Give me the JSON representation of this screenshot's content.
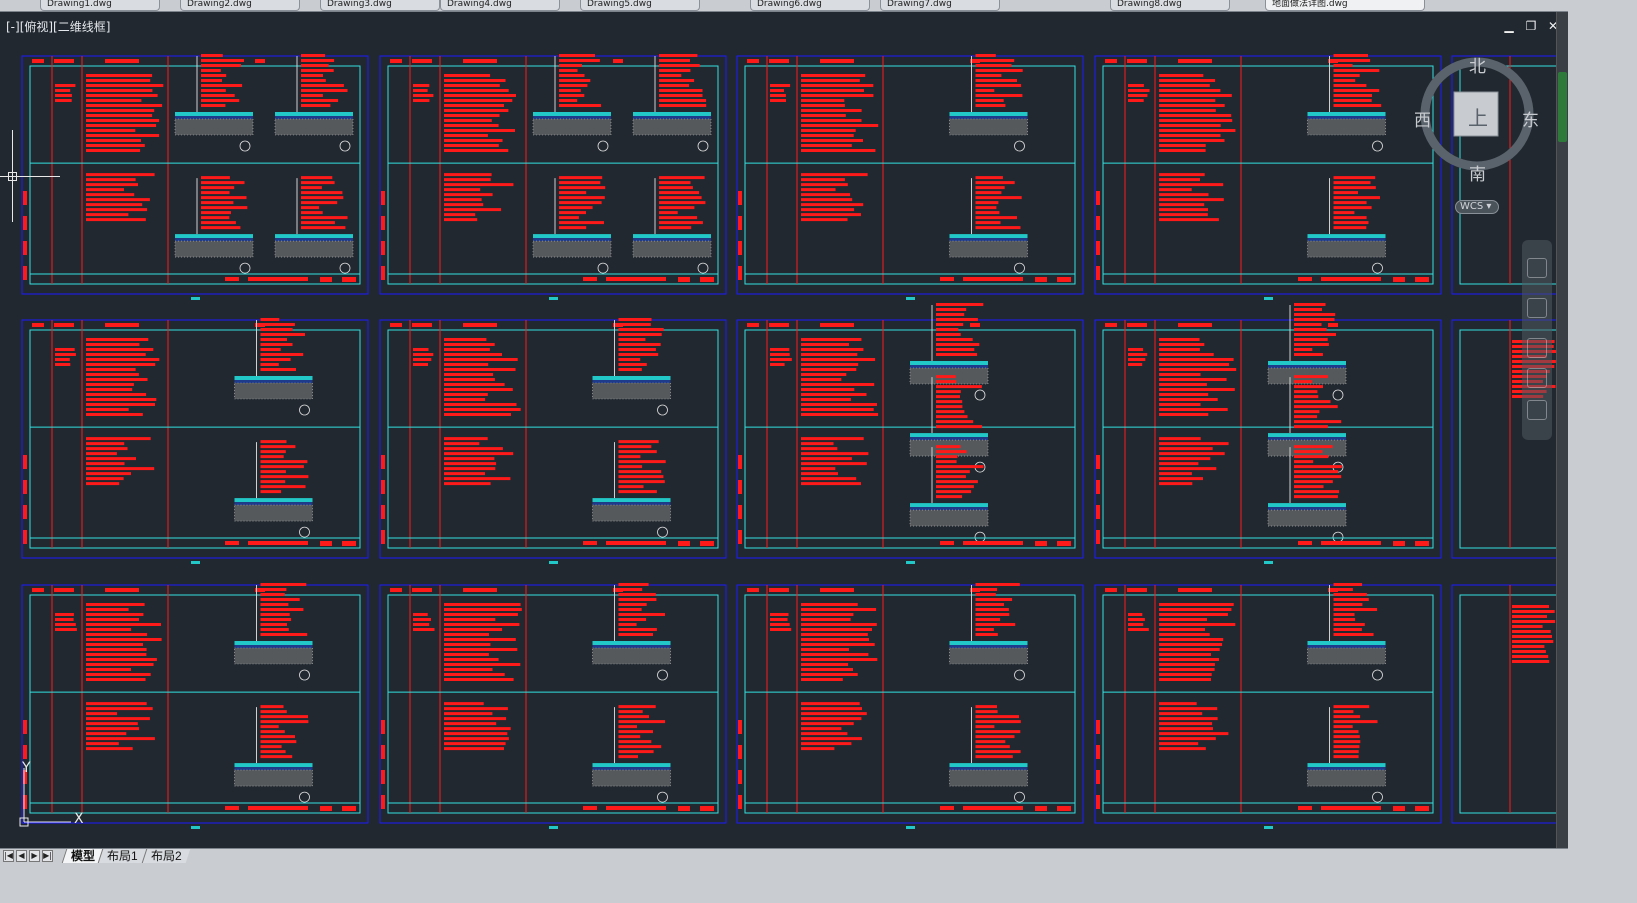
{
  "viewport": {
    "label": "[-][俯视][二维线框]"
  },
  "file_tabs": [
    {
      "label": "Drawing1.dwg"
    },
    {
      "label": "Drawing2.dwg"
    },
    {
      "label": "Drawing3.dwg"
    },
    {
      "label": "Drawing4.dwg"
    },
    {
      "label": "Drawing5.dwg"
    },
    {
      "label": "Drawing6.dwg"
    },
    {
      "label": "Drawing7.dwg"
    },
    {
      "label": "Drawing8.dwg"
    },
    {
      "label": "地面做法详图.dwg"
    }
  ],
  "window_controls": {
    "minimize": "▁",
    "restore": "❐",
    "close": "✕"
  },
  "viewcube": {
    "north": "北",
    "south": "南",
    "east": "东",
    "west": "西",
    "top_face": "上",
    "wcs_label": "WCS"
  },
  "ucs": {
    "x_label": "X",
    "y_label": "Y"
  },
  "layout_tabs": [
    {
      "label": "模型",
      "active": true
    },
    {
      "label": "布局1",
      "active": false
    },
    {
      "label": "布局2",
      "active": false
    }
  ],
  "nav_arrows": [
    "|◀",
    "◀",
    "▶",
    "▶|"
  ],
  "sheet_rows": [
    [
      {
        "details": 4,
        "divider": true
      },
      {
        "details": 4,
        "divider": true
      },
      {
        "details": 2,
        "divider": true
      },
      {
        "details": 2,
        "divider": true
      }
    ],
    [
      {
        "details": 2,
        "divider": true
      },
      {
        "details": 2,
        "divider": true
      },
      {
        "details": 3,
        "divider": true
      },
      {
        "details": 3,
        "divider": true
      }
    ],
    [
      {
        "details": 2,
        "divider": true
      },
      {
        "details": 2,
        "divider": true
      },
      {
        "details": 2,
        "divider": true
      },
      {
        "details": 2,
        "divider": true
      }
    ]
  ],
  "colors": {
    "background": "#212830",
    "sheet_border": "#1a1aff",
    "frame_line": "#33e0e0",
    "annotation": "#ff1a1a",
    "hatch": "#b8b8b8",
    "cyan_fill": "#22c8c8"
  }
}
